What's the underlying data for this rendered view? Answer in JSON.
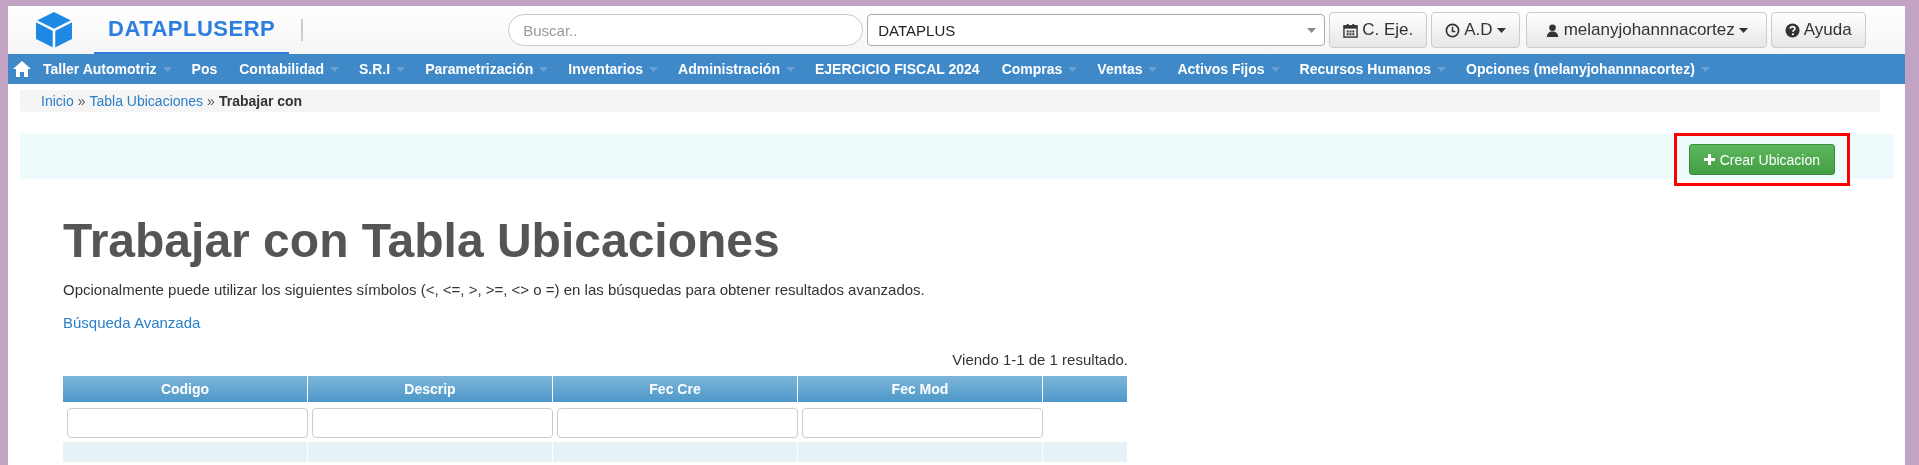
{
  "header": {
    "brand": "DATAPLUSERP",
    "search": {
      "placeholder": "Buscar.."
    },
    "company_select": {
      "value": "DATAPLUS"
    },
    "buttons": [
      {
        "kind": "calendar",
        "label": "C. Eje.",
        "caret": false
      },
      {
        "kind": "clock",
        "label": "A.D",
        "caret": true
      },
      {
        "kind": "user",
        "label": "melanyjohannnacortez",
        "caret": true
      },
      {
        "kind": "help",
        "label": "Ayuda",
        "caret": false
      }
    ]
  },
  "nav": {
    "items": [
      {
        "label": "Taller Automotriz",
        "caret": true
      },
      {
        "label": "Pos",
        "caret": false
      },
      {
        "label": "Contabilidad",
        "caret": true
      },
      {
        "label": "S.R.I",
        "caret": true
      },
      {
        "label": "Parametrización",
        "caret": true
      },
      {
        "label": "Inventarios",
        "caret": true
      },
      {
        "label": "Administración",
        "caret": true
      },
      {
        "label": "EJERCICIO FISCAL 2024",
        "caret": false
      },
      {
        "label": "Compras",
        "caret": true
      },
      {
        "label": "Ventas",
        "caret": true
      },
      {
        "label": "Activos Fijos",
        "caret": true
      },
      {
        "label": "Recursos Humanos",
        "caret": true
      },
      {
        "label": "Opciones (melanyjohannnacortez)",
        "caret": true
      }
    ]
  },
  "breadcrumb": [
    {
      "label": "Inicio",
      "kind": "link"
    },
    {
      "label": "Tabla Ubicaciones",
      "kind": "link"
    },
    {
      "label": "Trabajar con",
      "kind": "current"
    }
  ],
  "breadcrumb_separator": "»",
  "action_button": {
    "label": "Crear Ubicacion",
    "highlighted": true
  },
  "title": "Trabajar con Tabla Ubicaciones",
  "description": "Opcionalmente puede utilizar los siguientes símbolos (<, <=, >, >=, <> o =) en las búsquedas para obtener resultados avanzados.",
  "advanced_search_link": "Búsqueda Avanzada",
  "summary": "Viendo 1-1 de 1 resultado.",
  "table": {
    "columns": [
      "Codigo",
      "Descrip",
      "Fec Cre",
      "Fec Mod"
    ]
  }
}
